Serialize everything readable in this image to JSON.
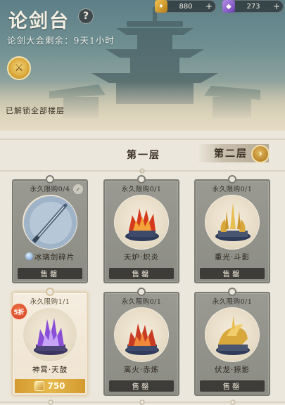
{
  "header": {
    "title": "论剑台",
    "countdown": "论剑大会剩余：9天1小时",
    "unlocked_text": "已解锁全部楼层",
    "help_icon": "question-icon",
    "emblem_icon": "sword-emblem-icon"
  },
  "currencies": [
    {
      "icon": "gold-coin-icon",
      "value": "880",
      "plus": "+"
    },
    {
      "icon": "jade-gem-icon",
      "value": "273",
      "plus": "+"
    }
  ],
  "floors": {
    "current": "第一层",
    "next": "第二层",
    "next_icon": "chevron-right-icon"
  },
  "cards": [
    {
      "limit": "永久限购0/4",
      "name": "冰璃剑碎片",
      "status": "售罄",
      "icon": "ice-sword-shard-icon",
      "badge": "owned-icon"
    },
    {
      "limit": "永久限购0/1",
      "name": "天炉·炽炎",
      "status": "售罄",
      "icon": "fire-furnace-icon"
    },
    {
      "limit": "永久限购0/1",
      "name": "重光·斗影",
      "status": "售罄",
      "icon": "golden-blades-icon"
    },
    {
      "limit": "永久限购1/1",
      "name": "神霄·天鼓",
      "price": "750",
      "discount": "5折",
      "icon": "thunder-drum-icon",
      "price_icon": "gold-coin-icon"
    },
    {
      "limit": "永久限购0/1",
      "name": "离火·赤炼",
      "status": "售罄",
      "icon": "red-flame-icon"
    },
    {
      "limit": "永久限购0/1",
      "name": "伏龙·掠影",
      "status": "售罄",
      "icon": "golden-dragon-icon"
    }
  ],
  "colors": {
    "accent_gold": "#d39a2f",
    "card_gray": "#8b8c84",
    "sold_bar": "#3d3c38",
    "discount_red": "#d8472a",
    "page_bg": "#ece7dc"
  }
}
